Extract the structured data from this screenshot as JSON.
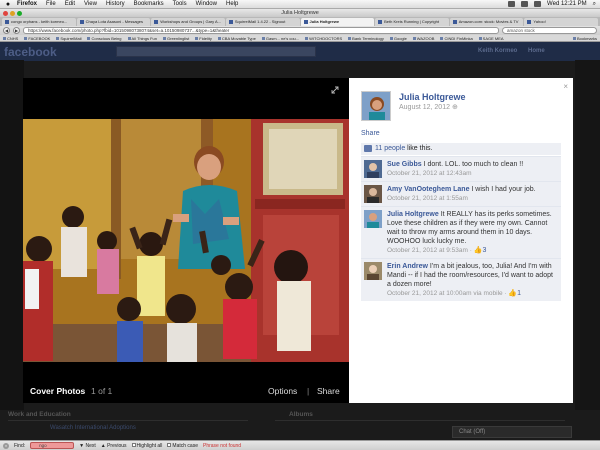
{
  "menubar": {
    "app": "Firefox",
    "items": [
      "File",
      "Edit",
      "View",
      "History",
      "Bookmarks",
      "Tools",
      "Window",
      "Help"
    ],
    "clock": "Wed 12:21 PM"
  },
  "window": {
    "title": "Julia Holtgrewe"
  },
  "browser_tabs": [
    "congo orphans - keith kormeo...",
    "Chaya Lota Asasoni - Messages",
    "Workshops and Groups | Gary A...",
    "SquirrelMail 1.4.22 - Signout",
    "Julia Holtgrewe",
    "Beth Kreis Running | Copyright",
    "Amazon.com: stock: Movies & TV",
    "Yahoo!"
  ],
  "url_bar": {
    "url": "https://www.facebook.com/photo.php?fbid=10150980738074&set=a.10150980737...&type=1&theater",
    "search": "amazon stock"
  },
  "bookmarks": [
    "CNHS",
    "FACEBOOK",
    "SquirrelMail",
    "Conscious Being",
    "All Things Fun",
    "Greenlinglist",
    "Fidelity",
    "CBA Movable Type",
    "Gasm... ne's cou...",
    "WITCHDOCTORS",
    "Bank Terminology",
    "Google",
    "WAZOOB",
    "CINDI FinMinka",
    "SAGE MEA",
    "Bookmarks"
  ],
  "fb": {
    "logo": "facebook",
    "user": "Keith Kormeo",
    "home": "Home",
    "section_left": "Work and Education",
    "section_right": "Albums",
    "adopt_link": "Wasatch International Adoptions",
    "chat": "Chat (Off)"
  },
  "photo_caption": {
    "album": "Cover Photos",
    "count": "1 of 1",
    "options": "Options",
    "separator": "|",
    "share": "Share"
  },
  "panel": {
    "close": "×",
    "owner_name": "Julia Holtgrewe",
    "date": "August 12, 2012",
    "share": "Share",
    "likes_count": "11 people",
    "likes_suffix": " like this.",
    "comments": [
      {
        "name": "Sue Gibbs",
        "text": "I dont. LOL. too much to clean !!",
        "meta": "October 21, 2012 at 12:43am",
        "likes": ""
      },
      {
        "name": "Amy VanOoteghem Lane",
        "text": "I wish I had your job.",
        "meta": "October 21, 2012 at 1:55am",
        "likes": ""
      },
      {
        "name": "Julia Holtgrewe",
        "text": "It REALLY has its perks sometimes. Love these children as if they were my own. Cannot wait to throw my arms around them in 10 days. WOOHOO luck lucky me.",
        "meta": "October 21, 2012 at 9:53am · ",
        "likes": "3"
      },
      {
        "name": "Erin Andrew",
        "text": "I'm a bit jealous, too, Julia! And I'm with Mandi -- if I had the room/resources, I'd want to adopt a dozen more!",
        "meta": "October 21, 2012 at 10:00am via mobile · ",
        "likes": "1"
      }
    ]
  },
  "findbar": {
    "label": "Find:",
    "value": "ngo",
    "next": "Next",
    "previous": "Previous",
    "highlight": "Highlight all",
    "match_case": "Match case",
    "status": "Phrase not found"
  },
  "colors": {
    "fb_blue": "#3b5998",
    "panel_bg": "#ffffff",
    "comment_bg": "#edeff4"
  }
}
